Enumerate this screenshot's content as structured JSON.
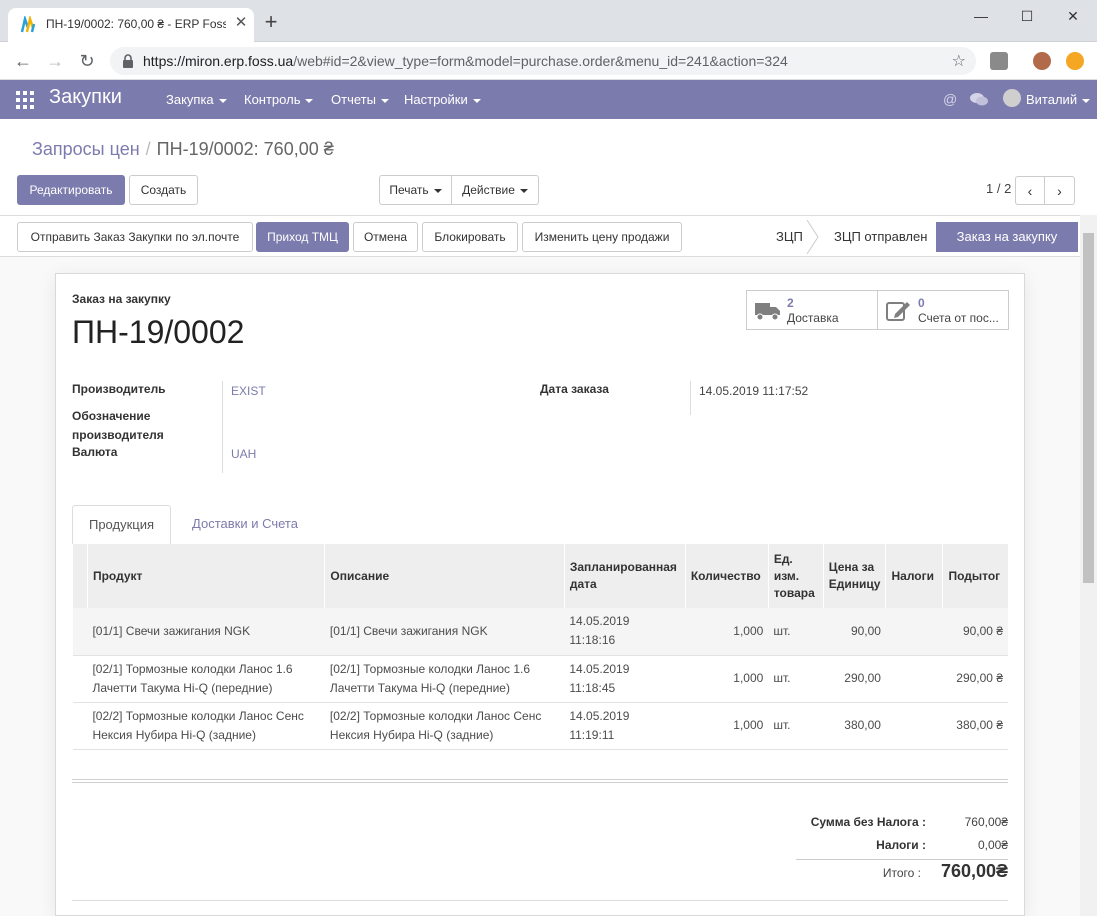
{
  "browser": {
    "tab_title": "ПН-19/0002: 760,00 ₴ - ERP Foss",
    "url_host": "https://miron.erp.foss.ua",
    "url_path": "/web#id=2&view_type=form&model=purchase.order&menu_id=241&action=324"
  },
  "topnav": {
    "app_name": "Закупки",
    "menus": [
      "Закупка",
      "Контроль",
      "Отчеты",
      "Настройки"
    ],
    "user_name": "Виталий",
    "accent_color": "#7c7bad"
  },
  "breadcrumb": {
    "parent": "Запросы цен",
    "current": "ПН-19/0002: 760,00 ₴"
  },
  "control": {
    "edit_label": "Редактировать",
    "create_label": "Создать",
    "print_label": "Печать",
    "action_label": "Действие",
    "pager": "1 / 2"
  },
  "header_buttons": {
    "send_email": "Отправить Заказ Закупки по эл.почте",
    "receive": "Приход ТМЦ",
    "cancel": "Отмена",
    "lock": "Блокировать",
    "change_price": "Изменить цену продажи"
  },
  "stages": [
    "ЗЦП",
    "ЗЦП отправлен",
    "Заказ на закупку"
  ],
  "smart_buttons": {
    "delivery": {
      "value": "2",
      "label": "Доставка",
      "icon": "truck-icon"
    },
    "bills": {
      "value": "0",
      "label": "Счета от пос...",
      "icon": "pencil-square-icon"
    }
  },
  "order": {
    "type_label": "Заказ на закупку",
    "name": "ПН-19/0002",
    "vendor_label": "Производитель",
    "vendor": "EXIST",
    "vendor_ref_label": "Обозначение производителя",
    "currency_label": "Валюта",
    "currency": "UAH",
    "date_label": "Дата заказа",
    "date": "14.05.2019 11:17:52"
  },
  "tabs": [
    "Продукция",
    "Доставки и Счета"
  ],
  "lines": {
    "headers": {
      "product": "Продукт",
      "description": "Описание",
      "planned_date": "Запланированная дата",
      "qty": "Количество",
      "uom": "Ед. изм. товара",
      "price": "Цена за Единицу",
      "taxes": "Налоги",
      "subtotal": "Подытог"
    },
    "rows": [
      {
        "product": "[01/1] Свечи зажигания NGK",
        "description": "[01/1] Свечи зажигания NGK",
        "date": "14.05.2019",
        "time": "11:18:16",
        "qty": "1,000",
        "uom": "шт.",
        "price": "90,00",
        "taxes": "",
        "subtotal": "90,00 ₴"
      },
      {
        "product": "[02/1] Тормозные колодки Ланос 1.6 Лачетти Такума Hi-Q (передние)",
        "description": "[02/1] Тормозные колодки Ланос 1.6 Лачетти Такума Hi-Q (передние)",
        "date": "14.05.2019",
        "time": "11:18:45",
        "qty": "1,000",
        "uom": "шт.",
        "price": "290,00",
        "taxes": "",
        "subtotal": "290,00 ₴"
      },
      {
        "product": "[02/2] Тормозные колодки Ланос Сенс Нексия Нубира Hi-Q (задние)",
        "description": "[02/2] Тормозные колодки Ланос Сенс Нексия Нубира Hi-Q (задние)",
        "date": "14.05.2019",
        "time": "11:19:11",
        "qty": "1,000",
        "uom": "шт.",
        "price": "380,00",
        "taxes": "",
        "subtotal": "380,00 ₴"
      }
    ]
  },
  "totals": {
    "untaxed_label": "Сумма без Налога :",
    "untaxed": "760,00₴",
    "taxes_label": "Налоги :",
    "taxes": "0,00₴",
    "total_label": "Итого :",
    "total": "760,00₴"
  }
}
